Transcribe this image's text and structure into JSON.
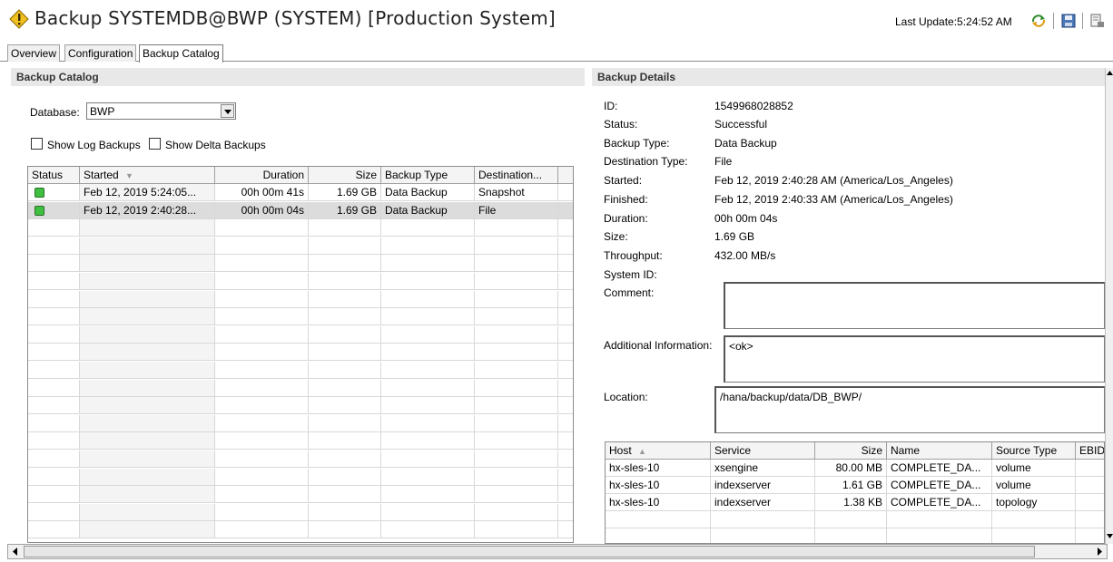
{
  "title": "Backup SYSTEMDB@BWP (SYSTEM) [Production System]",
  "last_update": "Last Update:5:24:52 AM",
  "tabs": [
    "Overview",
    "Configuration",
    "Backup Catalog"
  ],
  "catalog": {
    "header": "Backup Catalog",
    "database_label": "Database:",
    "database_value": "BWP",
    "show_log_label": "Show Log Backups",
    "show_delta_label": "Show Delta Backups",
    "columns": [
      "Status",
      "Started",
      "Duration",
      "Size",
      "Backup Type",
      "Destination..."
    ],
    "rows": [
      {
        "started": "Feb 12, 2019 5:24:05...",
        "duration": "00h 00m 41s",
        "size": "1.69 GB",
        "type": "Data Backup",
        "dest": "Snapshot"
      },
      {
        "started": "Feb 12, 2019 2:40:28...",
        "duration": "00h 00m 04s",
        "size": "1.69 GB",
        "type": "Data Backup",
        "dest": "File"
      }
    ]
  },
  "details": {
    "header": "Backup Details",
    "id_label": "ID:",
    "id": "1549968028852",
    "status_label": "Status:",
    "status": "Successful",
    "backup_type_label": "Backup Type:",
    "backup_type": "Data Backup",
    "dest_type_label": "Destination Type:",
    "dest_type": "File",
    "started_label": "Started:",
    "started": "Feb 12, 2019 2:40:28 AM (America/Los_Angeles)",
    "finished_label": "Finished:",
    "finished": "Feb 12, 2019 2:40:33 AM (America/Los_Angeles)",
    "duration_label": "Duration:",
    "duration": "00h 00m 04s",
    "size_label": "Size:",
    "size": "1.69 GB",
    "throughput_label": "Throughput:",
    "throughput": "432.00 MB/s",
    "system_id_label": "System ID:",
    "comment_label": "Comment:",
    "additional_label": "Additional Information:",
    "additional": "<ok>",
    "location_label": "Location:",
    "location": "/hana/backup/data/DB_BWP/",
    "service_columns": [
      "Host",
      "Service",
      "Size",
      "Name",
      "Source Type",
      "EBID"
    ],
    "services": [
      {
        "host": "hx-sles-10",
        "service": "xsengine",
        "size": "80.00 MB",
        "name": "COMPLETE_DA...",
        "source": "volume"
      },
      {
        "host": "hx-sles-10",
        "service": "indexserver",
        "size": "1.61 GB",
        "name": "COMPLETE_DA...",
        "source": "volume"
      },
      {
        "host": "hx-sles-10",
        "service": "indexserver",
        "size": "1.38 KB",
        "name": "COMPLETE_DA...",
        "source": "topology"
      }
    ]
  }
}
